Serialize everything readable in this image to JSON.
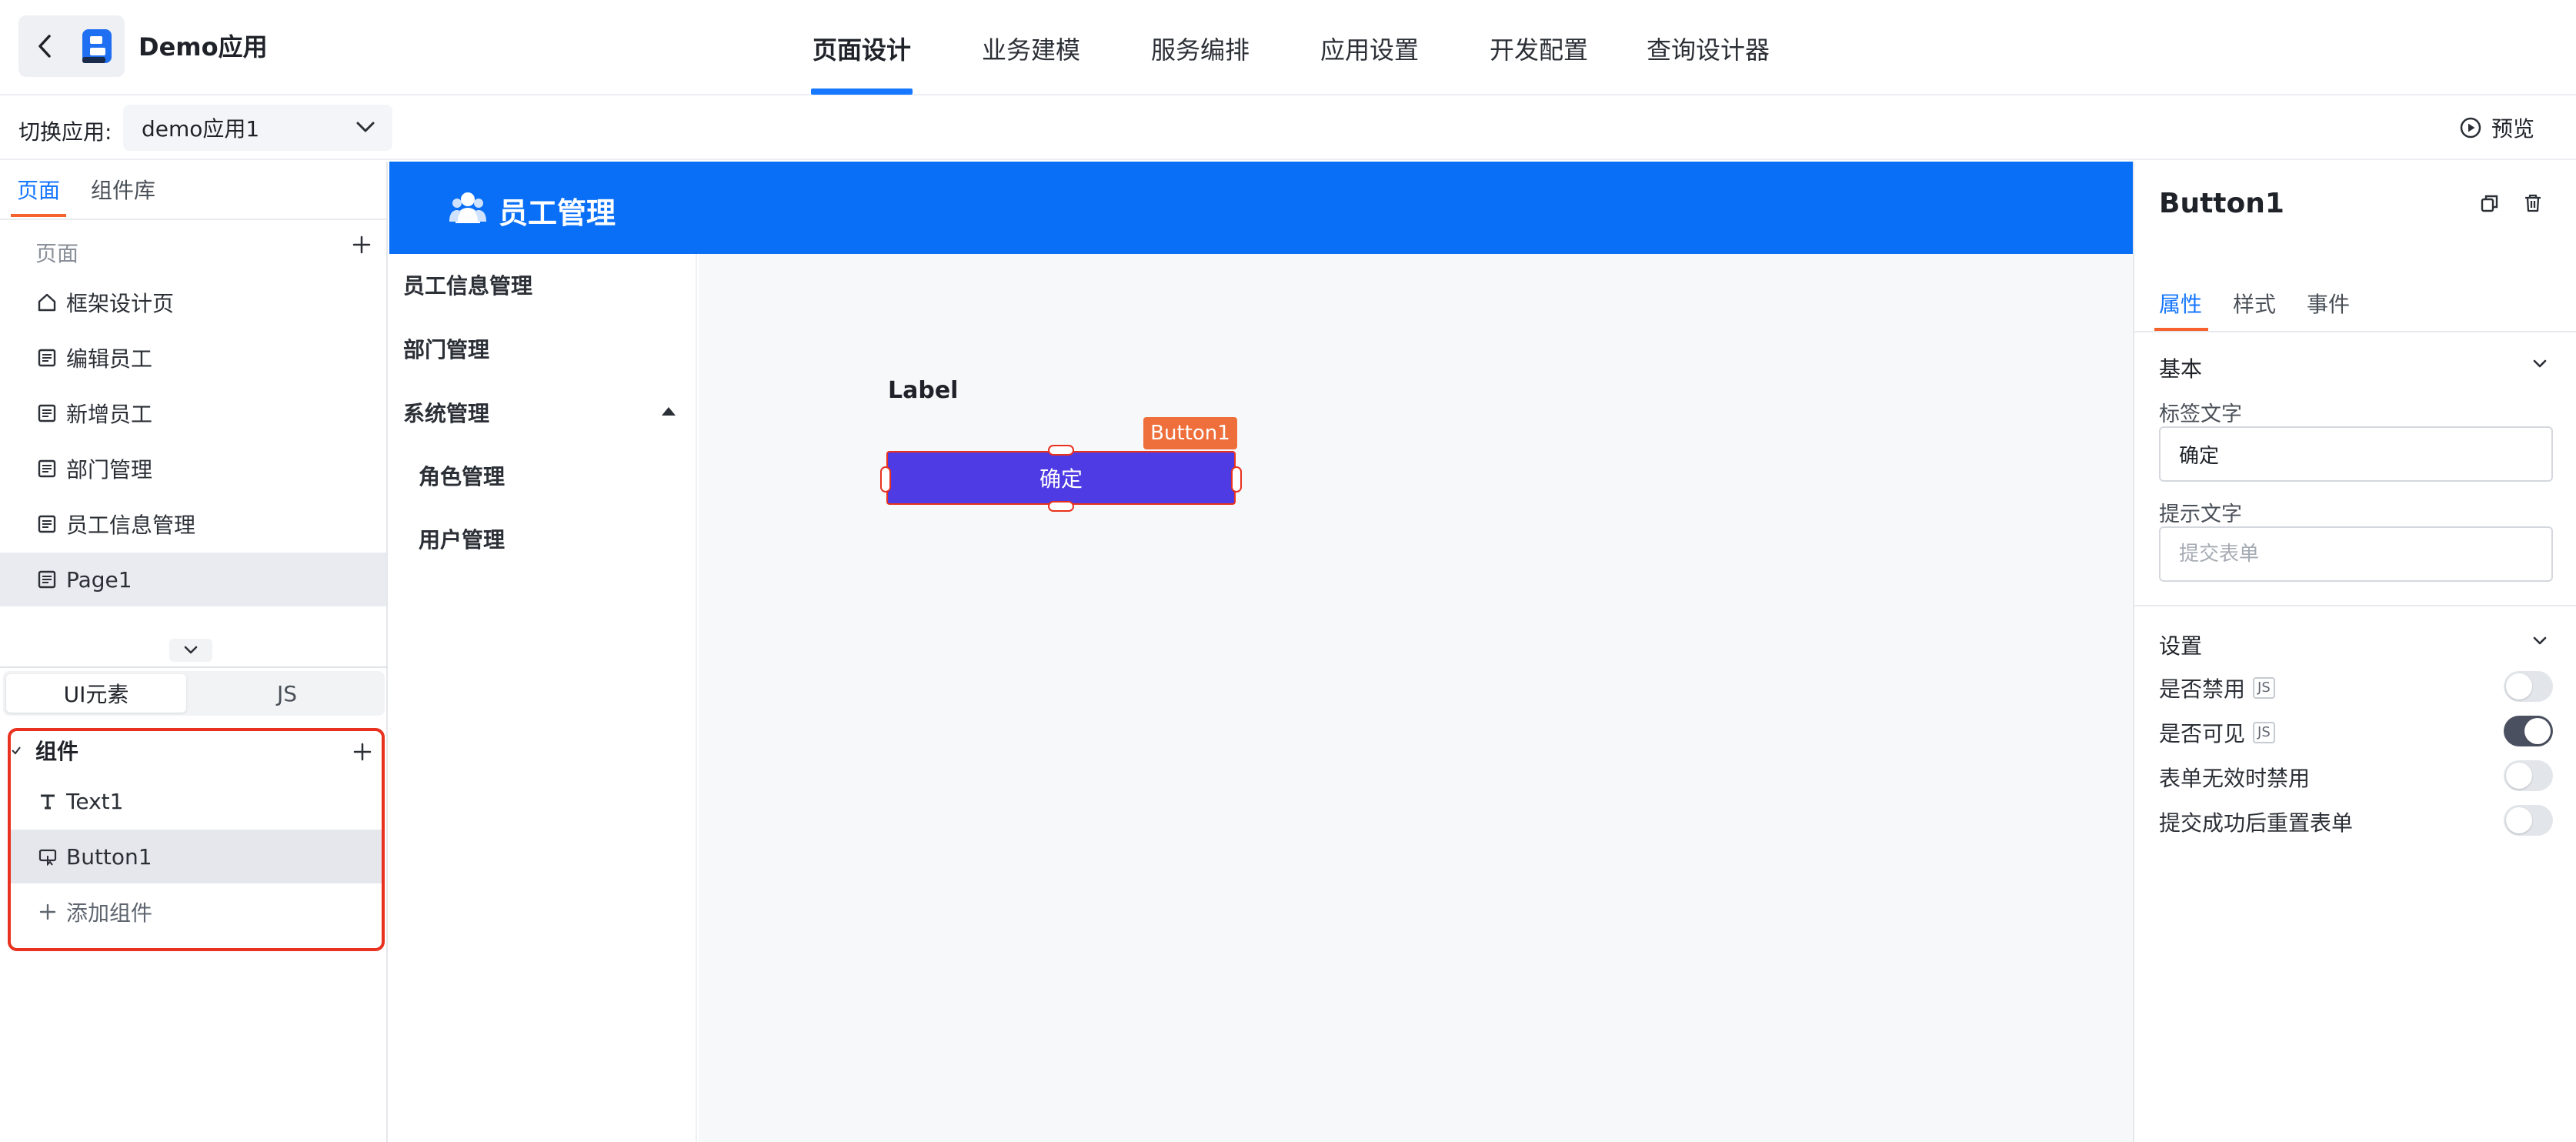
{
  "header": {
    "app_name": "Demo应用",
    "tabs": [
      {
        "label": "页面设计",
        "active": true
      },
      {
        "label": "业务建模"
      },
      {
        "label": "服务编排"
      },
      {
        "label": "应用设置"
      },
      {
        "label": "开发配置"
      },
      {
        "label": "查询设计器"
      }
    ]
  },
  "subbar": {
    "switch_label": "切换应用:",
    "selected_app": "demo应用1",
    "preview_label": "预览"
  },
  "left_panel": {
    "tabs": [
      "页面",
      "组件库"
    ],
    "pages_header": "页面",
    "pages": [
      {
        "label": "框架设计页",
        "icon": "home-icon"
      },
      {
        "label": "编辑员工",
        "icon": "page-icon"
      },
      {
        "label": "新增员工",
        "icon": "page-icon"
      },
      {
        "label": "部门管理",
        "icon": "page-icon"
      },
      {
        "label": "员工信息管理",
        "icon": "page-icon"
      },
      {
        "label": "Page1",
        "icon": "page-icon",
        "selected": true
      }
    ],
    "segment": [
      "UI元素",
      "JS"
    ],
    "components_title": "组件",
    "components": [
      {
        "label": "Text1",
        "icon": "text-icon"
      },
      {
        "label": "Button1",
        "icon": "button-icon",
        "selected": true
      }
    ],
    "add_component": "添加组件"
  },
  "canvas": {
    "header_title": "员工管理",
    "menu": [
      "员工信息管理",
      "部门管理",
      "系统管理",
      "角色管理",
      "用户管理"
    ],
    "label": "Label",
    "button_badge": "Button1",
    "button_text": "确定"
  },
  "right_panel": {
    "title": "Button1",
    "tabs": [
      "属性",
      "样式",
      "事件"
    ],
    "basic_section": "基本",
    "label_text_field": "标签文字",
    "label_text_value": "确定",
    "hint_text_field": "提示文字",
    "hint_text_placeholder": "提交表单",
    "settings_section": "设置",
    "settings": [
      {
        "label": "是否禁用",
        "js": "JS",
        "on": false
      },
      {
        "label": "是否可见",
        "js": "JS",
        "on": true
      },
      {
        "label": "表单无效时禁用",
        "on": false
      },
      {
        "label": "提交成功后重置表单",
        "on": false
      }
    ]
  },
  "colors": {
    "accent": "#1677ff",
    "tab_underline": "#f5622d",
    "canvas_header": "#0a6ff7",
    "canvas_button": "#4f3be3",
    "selection_outline": "#e8321f",
    "badge": "#ee6f3b"
  }
}
